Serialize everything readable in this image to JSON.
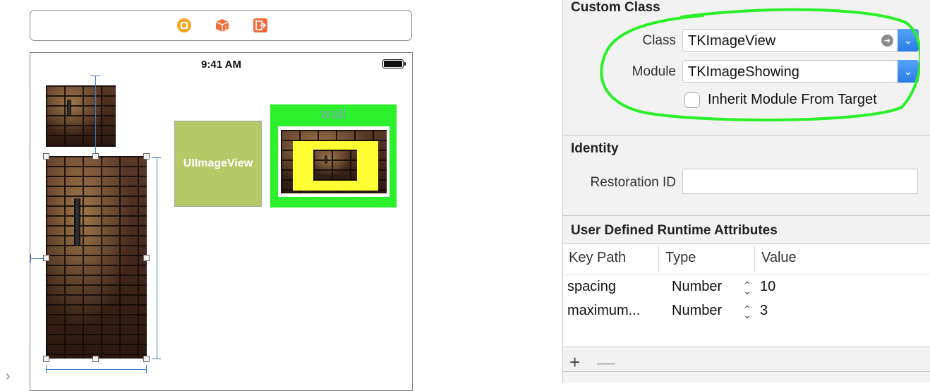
{
  "canvas": {
    "status_time": "9:41 AM",
    "placeholder_label": "UIImageView",
    "wall_label": "wall"
  },
  "dock": {
    "icons": [
      "view-controller-icon",
      "first-responder-icon",
      "exit-icon"
    ],
    "colors": {
      "view_controller": "#f5a623",
      "first_responder": "#f0703a",
      "exit": "#f26a3c"
    }
  },
  "inspector": {
    "custom_class": {
      "title": "Custom Class",
      "class_label": "Class",
      "class_value": "TKImageView",
      "module_label": "Module",
      "module_value": "TKImageShowing",
      "inherit_label": "Inherit Module From Target",
      "inherit_checked": false
    },
    "identity": {
      "title": "Identity",
      "restoration_label": "Restoration ID",
      "restoration_value": ""
    },
    "runtime_attributes": {
      "title": "User Defined Runtime Attributes",
      "columns": [
        "Key Path",
        "Type",
        "Value"
      ],
      "rows": [
        {
          "key_path": "spacing",
          "type": "Number",
          "value": "10"
        },
        {
          "key_path": "maximum...",
          "type": "Number",
          "value": "3"
        }
      ],
      "add_symbol": "+",
      "remove_symbol": "—"
    }
  },
  "colors": {
    "accent_blue": "#2a7ce6",
    "annotation_green": "#2af02a",
    "wall_green": "#2bf02b",
    "yellow": "#ffff33",
    "placeholder": "#b7c866"
  }
}
